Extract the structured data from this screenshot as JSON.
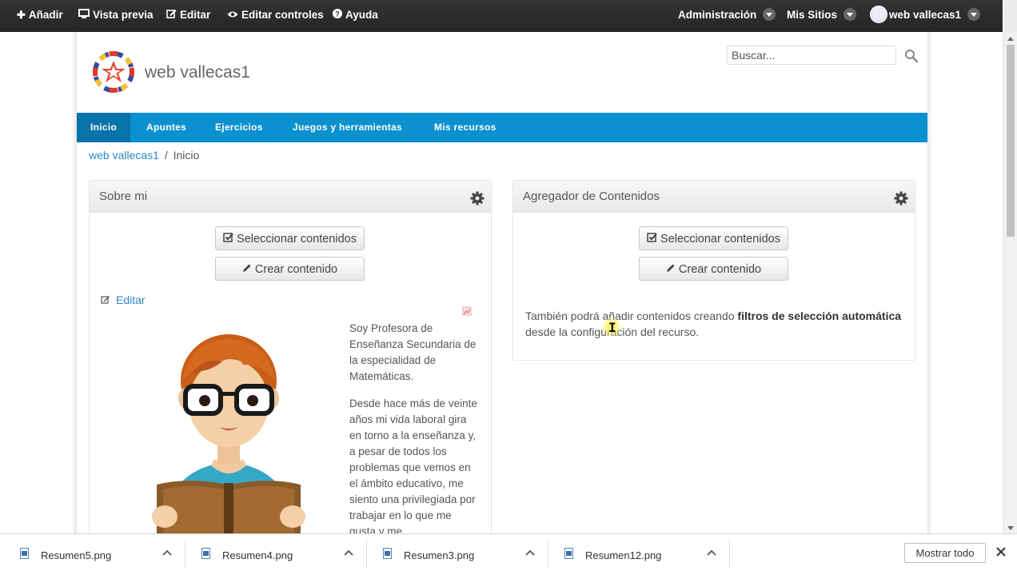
{
  "dockbar": {
    "add": "Añadir",
    "preview": "Vista previa",
    "edit": "Editar",
    "edit_controls": "Editar controles",
    "help": "Ayuda",
    "admin": "Administración",
    "my_sites": "Mis Sitios",
    "user": "web vallecas1"
  },
  "header": {
    "site_name": "web vallecas1",
    "search_placeholder": "Buscar..."
  },
  "nav": {
    "items": [
      "Inicio",
      "Apuntes",
      "Ejercicios",
      "Juegos y herramientas",
      "Mis recursos"
    ],
    "active": "Inicio"
  },
  "breadcrumb": {
    "site": "web vallecas1",
    "separator": "/",
    "current": "Inicio"
  },
  "portlet_about": {
    "title": "Sobre mi",
    "select_btn": "Seleccionar contenidos",
    "create_btn": "Crear contenido",
    "edit_link": "Editar",
    "para1": "Soy Profesora de Enseñanza Secundaria de la especialidad de Matemáticas.",
    "para2": "Desde hace más de veinte años mi vida laboral gira en torno a la enseñanza y, a pesar de todos los problemas que vemos en el ámbito educativo, me siento una privilegiada por trabajar en lo que me gusta y me"
  },
  "portlet_aggregator": {
    "title": "Agregador de Contenidos",
    "select_btn": "Seleccionar contenidos",
    "create_btn": "Crear contenido",
    "info_pre": "También podrá añadir contenidos creando ",
    "info_bold": "filtros de selección automática",
    "info_post": " desde la configuración del recurso."
  },
  "downloads": {
    "items": [
      "Resumen5.png",
      "Resumen4.png",
      "Resumen3.png",
      "Resumen12.png"
    ],
    "show_all": "Mostrar todo"
  },
  "colors": {
    "nav_blue": "#0b90d0",
    "nav_active": "#0873a8",
    "link_blue": "#2a87c8",
    "dockbar": "#2b2b2b"
  }
}
